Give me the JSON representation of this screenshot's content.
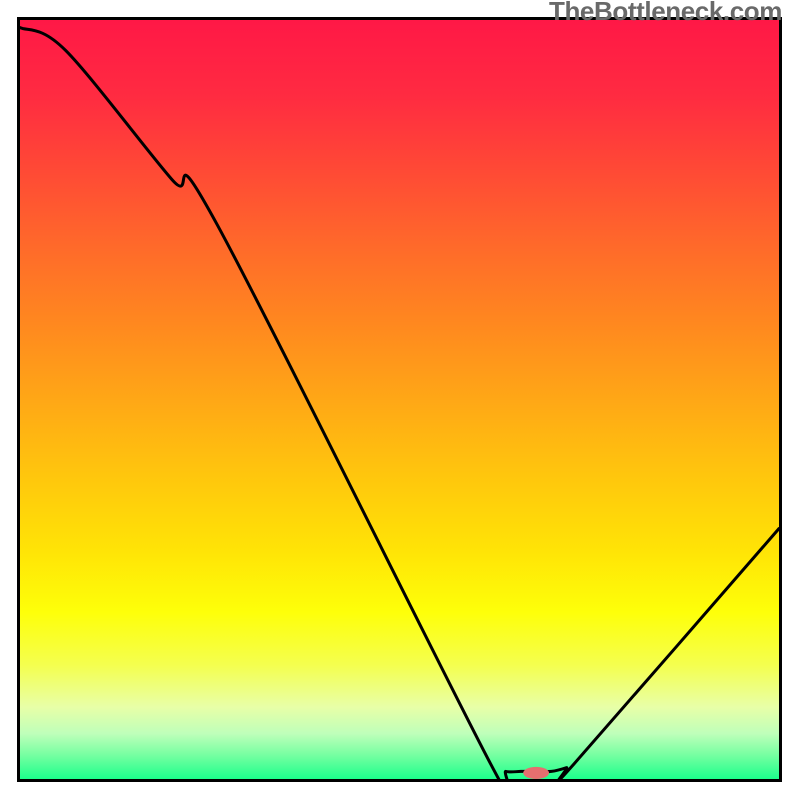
{
  "watermark": "TheBottleneck.com",
  "chart_data": {
    "type": "line",
    "title": "",
    "xlabel": "",
    "ylabel": "",
    "xlim": [
      0,
      100
    ],
    "ylim": [
      0,
      100
    ],
    "x": [
      0,
      6,
      20,
      26,
      62,
      64,
      66,
      68,
      70,
      72,
      73,
      100
    ],
    "values": [
      99,
      96,
      79,
      73,
      2,
      1,
      1,
      1,
      1,
      1.5,
      2,
      33
    ],
    "marker": {
      "x_pct": 68,
      "y_pct": 0.8,
      "rx_pct": 1.7,
      "ry_pct": 0.8
    },
    "gradient_stops": [
      {
        "offset": 0.0,
        "color": "#ff1846"
      },
      {
        "offset": 0.1,
        "color": "#ff2b41"
      },
      {
        "offset": 0.2,
        "color": "#ff4a35"
      },
      {
        "offset": 0.3,
        "color": "#ff6a2a"
      },
      {
        "offset": 0.4,
        "color": "#ff881f"
      },
      {
        "offset": 0.5,
        "color": "#ffa716"
      },
      {
        "offset": 0.6,
        "color": "#ffc60d"
      },
      {
        "offset": 0.7,
        "color": "#ffe406"
      },
      {
        "offset": 0.78,
        "color": "#feff09"
      },
      {
        "offset": 0.85,
        "color": "#f4ff4f"
      },
      {
        "offset": 0.905,
        "color": "#e8ffa7"
      },
      {
        "offset": 0.94,
        "color": "#bfffba"
      },
      {
        "offset": 0.97,
        "color": "#72ffa0"
      },
      {
        "offset": 1.0,
        "color": "#1cff8c"
      }
    ],
    "marker_color": "#e56f6f",
    "curve_color": "#000000"
  }
}
